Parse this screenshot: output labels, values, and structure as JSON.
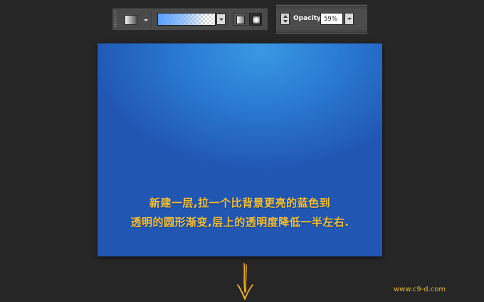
{
  "toolbar_gradient": {
    "preset_icon": "gradient-preset-icon",
    "gradient_picker_icon": "gradient-swatch",
    "linear_shape_icon": "linear-gradient-icon",
    "radial_shape_icon": "radial-gradient-icon",
    "gradient_color": "#5aa0ff",
    "selected_shape": "radial"
  },
  "toolbar_opacity": {
    "label": "Opacity:",
    "value": "59%"
  },
  "canvas": {
    "line1": "新建一层,拉一个比背景更亮的蓝色到",
    "line2": "透明的圆形渐变,层上的透明度降低一半左右.",
    "bg_color": "#2156b3",
    "highlight_color": "#3a98e3",
    "text_color": "#f4c036"
  },
  "watermark": "www.c9-d.com",
  "arrow_icon": "down-arrow-icon"
}
